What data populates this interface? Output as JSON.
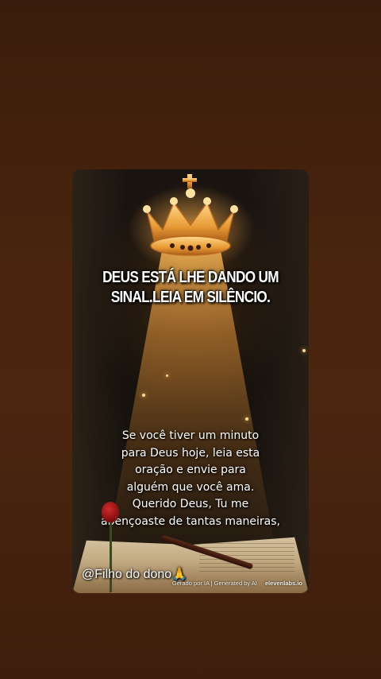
{
  "story": {
    "headline_lines": [
      "DEUS ESTÁ LHE DANDO UM",
      "SINAL.LEIA EM SILÊNCIO."
    ],
    "prayer_lines": [
      "Se você tiver um minuto",
      "para Deus hoje, leia esta",
      "oração e envie para",
      "alguém que você ama.",
      "Querido Deus, Tu me",
      "abençoaste de tantas maneiras,"
    ],
    "username": "@Filho do dono🙏",
    "ai_credit": "Gerado por IA | Generated by AI",
    "brand": "elevenlabs.io"
  },
  "colors": {
    "background": "#4a240e",
    "text": "#ffffff",
    "glow": "#ffb84a"
  },
  "icons": [
    "crown-icon",
    "rose-icon",
    "pen-icon",
    "book-icon"
  ]
}
